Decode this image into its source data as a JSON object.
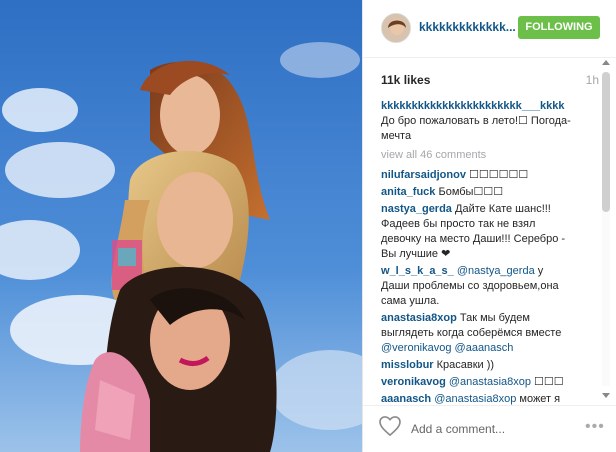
{
  "post": {
    "username": "kkkkkkkkkkkkk...",
    "follow_label": "FOLLOWING",
    "likes": "11k likes",
    "age": "1h"
  },
  "caption": {
    "user": "kkkkkkkkkkkkkkkkkkkkkkk___kkkk",
    "text": "До бро пожаловать в лето!☐ Погода-мечта"
  },
  "view_all": "view all 46 comments",
  "comments": [
    {
      "user": "nilufarsaidjonov",
      "text": "☐☐☐☐☐☐"
    },
    {
      "user": "anita_fuck",
      "text": "Бомбы☐☐☐"
    },
    {
      "user": "nastya_gerda",
      "text": "Дайте Кате шанс!!! Фадеев бы просто так не взял девочку на место Даши!!! Серебро - Вы лучшие ❤"
    },
    {
      "user": "w_l_s_k_a_s_",
      "mention": "@nastya_gerda",
      "text": "у Даши проблемы со здоровьем,она сама ушла."
    },
    {
      "user": "anastasia8xop",
      "text": "Так мы будем выглядеть когда соберёмся вместе",
      "mention2": "@veronikavog @aaanasch"
    },
    {
      "user": "misslobur",
      "text": "Красавки ))"
    },
    {
      "user": "veronikavog",
      "mention": "@anastasia8xop",
      "text": "☐☐☐"
    },
    {
      "user": "aaanasch",
      "mention": "@anastasia8xop",
      "text": "может я"
    }
  ],
  "footer": {
    "add_comment": "Add a comment...",
    "more": "•••"
  }
}
